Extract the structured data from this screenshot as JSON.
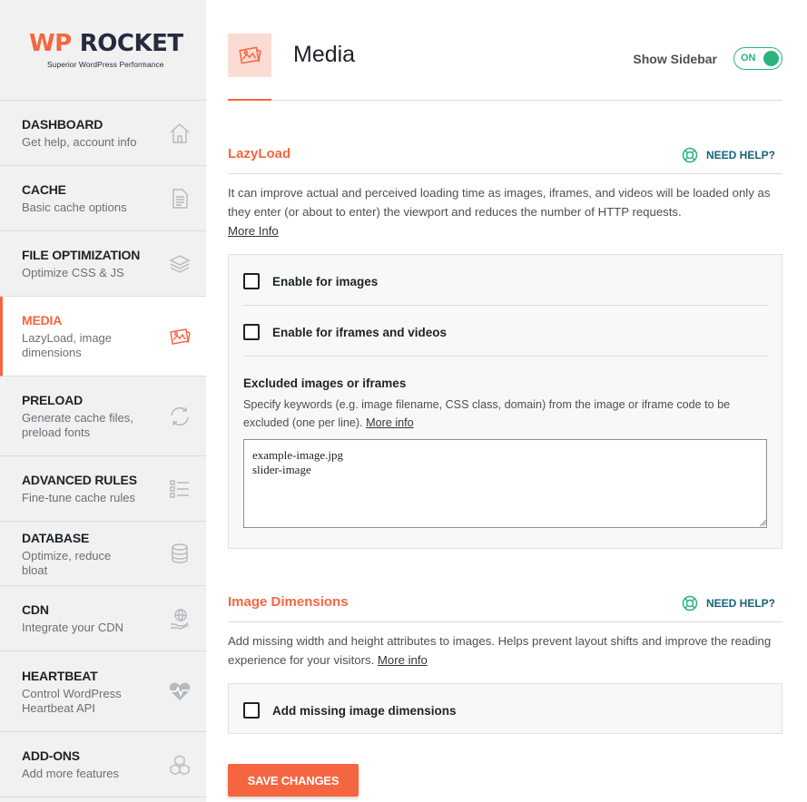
{
  "brand": {
    "name_part1": "WP",
    "name_part2": "ROCKET",
    "tagline": "Superior WordPress Performance",
    "accent_color": "#f56640",
    "dark_color": "#272b3e"
  },
  "sidebar": {
    "items": [
      {
        "title": "DASHBOARD",
        "desc": "Get help, account info",
        "icon": "home-icon"
      },
      {
        "title": "CACHE",
        "desc": "Basic cache options",
        "icon": "document-icon"
      },
      {
        "title": "FILE OPTIMIZATION",
        "desc": "Optimize CSS & JS",
        "icon": "layers-icon"
      },
      {
        "title": "MEDIA",
        "desc": "LazyLoad, image dimensions",
        "icon": "images-icon",
        "active": true
      },
      {
        "title": "PRELOAD",
        "desc": "Generate cache files, preload fonts",
        "icon": "refresh-icon"
      },
      {
        "title": "ADVANCED RULES",
        "desc": "Fine-tune cache rules",
        "icon": "checklist-icon"
      },
      {
        "title": "DATABASE",
        "desc": "Optimize, reduce bloat",
        "icon": "database-icon"
      },
      {
        "title": "CDN",
        "desc": "Integrate your CDN",
        "icon": "globe-hand-icon"
      },
      {
        "title": "HEARTBEAT",
        "desc": "Control WordPress Heartbeat API",
        "icon": "heartbeat-icon"
      },
      {
        "title": "ADD-ONS",
        "desc": "Add more features",
        "icon": "cubes-icon"
      }
    ]
  },
  "header": {
    "title": "Media",
    "show_sidebar_label": "Show Sidebar",
    "toggle_state": "ON"
  },
  "lazyload": {
    "title": "LazyLoad",
    "need_help": "NEED HELP?",
    "desc": "It can improve actual and perceived loading time as images, iframes, and videos will be loaded only as they enter (or about to enter) the viewport and reduces the number of HTTP requests.",
    "more_info": "More Info",
    "opt_images": "Enable for images",
    "opt_images_checked": false,
    "opt_iframes": "Enable for iframes and videos",
    "opt_iframes_checked": false,
    "excluded_title": "Excluded images or iframes",
    "excluded_desc": "Specify keywords (e.g. image filename, CSS class, domain) from the image or iframe code to be excluded (one per line).",
    "excluded_more": "More info",
    "excluded_value": "example-image.jpg\nslider-image"
  },
  "image_dimensions": {
    "title": "Image Dimensions",
    "need_help": "NEED HELP?",
    "desc": "Add missing width and height attributes to images. Helps prevent layout shifts and improve the reading experience for your visitors.",
    "more_info": "More info",
    "opt_dimensions": "Add missing image dimensions",
    "opt_dimensions_checked": false
  },
  "actions": {
    "save_label": "SAVE CHANGES"
  }
}
